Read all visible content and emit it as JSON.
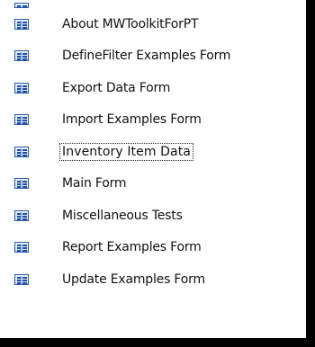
{
  "forms_list": {
    "items": [
      {
        "label": "About MWToolkitForPT",
        "icon": "form-icon",
        "selected": false
      },
      {
        "label": "DefineFilter Examples Form",
        "icon": "form-icon",
        "selected": false
      },
      {
        "label": "Export Data Form",
        "icon": "form-icon",
        "selected": false
      },
      {
        "label": "Import Examples Form",
        "icon": "form-icon",
        "selected": false
      },
      {
        "label": "Inventory Item Data",
        "icon": "form-icon",
        "selected": true
      },
      {
        "label": "Main Form",
        "icon": "form-icon",
        "selected": false
      },
      {
        "label": "Miscellaneous Tests",
        "icon": "form-icon",
        "selected": false
      },
      {
        "label": "Report Examples Form",
        "icon": "form-icon",
        "selected": false
      },
      {
        "label": "Update Examples Form",
        "icon": "form-icon",
        "selected": false
      }
    ]
  },
  "colors": {
    "background": "#ffffff",
    "frame": "#000000",
    "icon_border": "#2a5aa8",
    "text": "#111111"
  }
}
